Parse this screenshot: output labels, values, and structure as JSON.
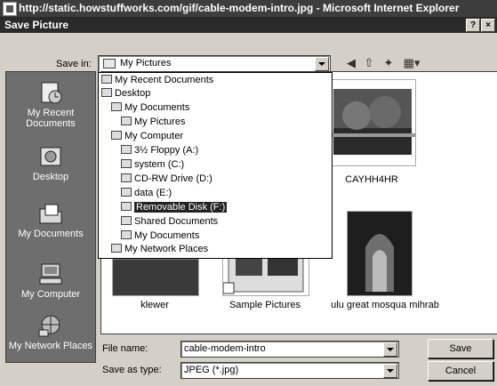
{
  "browser": {
    "title": "http://static.howstuffworks.com/gif/cable-modem-intro.jpg - Microsoft Internet Explorer"
  },
  "dialog": {
    "title": "Save Picture",
    "help_label": "?",
    "close_label": "×",
    "save_in_label": "Save in:",
    "save_in_value": "My Pictures"
  },
  "toolbar": {
    "back_icon": "back-icon",
    "up_icon": "up-folder-icon",
    "new_folder_icon": "new-folder-icon",
    "views_icon": "views-icon"
  },
  "places": [
    {
      "label": "My Recent Documents",
      "icon": "recent-documents-icon"
    },
    {
      "label": "Desktop",
      "icon": "desktop-icon"
    },
    {
      "label": "My Documents",
      "icon": "my-documents-icon"
    },
    {
      "label": "My Computer",
      "icon": "my-computer-icon"
    },
    {
      "label": "My Network Places",
      "icon": "network-places-icon"
    }
  ],
  "dropdown_items": [
    {
      "label": "My Recent Documents",
      "icon": "recent-icon"
    },
    {
      "label": "Desktop",
      "icon": "desktop-icon"
    },
    {
      "label": "My Documents",
      "icon": "folder-icon"
    },
    {
      "label": "My Pictures",
      "icon": "pictures-folder-icon"
    },
    {
      "label": "My Computer",
      "icon": "computer-icon"
    },
    {
      "label": "3½ Floppy (A:)",
      "icon": "floppy-icon"
    },
    {
      "label": "system (C:)",
      "icon": "drive-icon"
    },
    {
      "label": "CD-RW Drive (D:)",
      "icon": "cd-drive-icon"
    },
    {
      "label": "data (E:)",
      "icon": "drive-icon"
    },
    {
      "label": "Removable Disk (F:)",
      "icon": "removable-disk-icon",
      "selected": true
    },
    {
      "label": "Shared Documents",
      "icon": "folder-icon"
    },
    {
      "label": "My Documents",
      "icon": "folder-icon"
    },
    {
      "label": "My Network Places",
      "icon": "network-icon"
    }
  ],
  "files": [
    {
      "label": "CAYHH4HR"
    },
    {
      "label": "klewer"
    },
    {
      "label": "Sample Pictures"
    },
    {
      "label": "ulu great mosqua mihrab"
    }
  ],
  "form": {
    "file_name_label": "File name:",
    "file_name_value": "cable-modem-intro",
    "save_type_label": "Save as type:",
    "save_type_value": "JPEG (*.jpg)"
  },
  "buttons": {
    "save": "Save",
    "cancel": "Cancel"
  }
}
